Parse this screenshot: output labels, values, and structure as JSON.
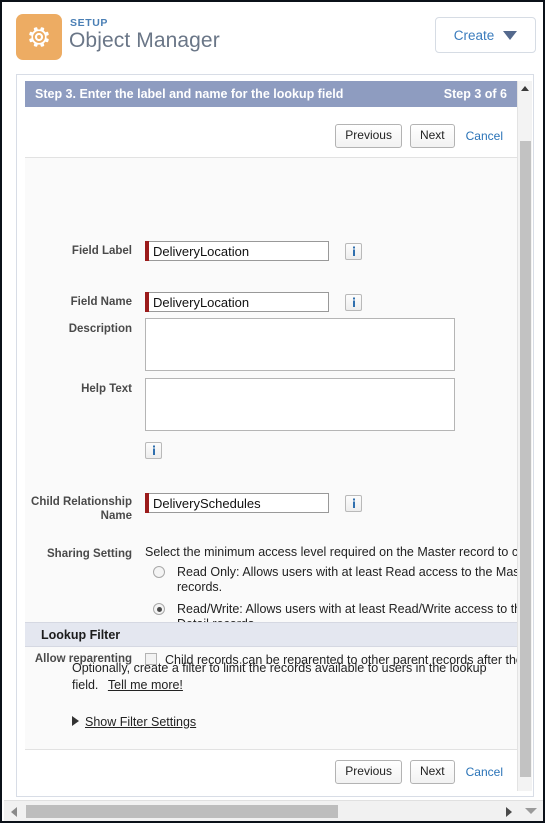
{
  "header": {
    "eyebrow": "SETUP",
    "title": "Object Manager",
    "gear_icon": "gear-icon",
    "create_button": {
      "label": "Create",
      "caret_icon": "chevron-down-icon"
    }
  },
  "wizard": {
    "step_title": "Step 3. Enter the label and name for the lookup field",
    "step_counter": "Step 3 of 6",
    "buttons": {
      "previous": "Previous",
      "next": "Next",
      "cancel": "Cancel"
    },
    "fields": {
      "field_label": {
        "label": "Field Label",
        "value": "DeliveryLocation",
        "placeholder": "",
        "info_icon": "info-icon"
      },
      "field_name": {
        "label": "Field Name",
        "value": "DeliveryLocation",
        "placeholder": "",
        "info_icon": "info-icon"
      },
      "description": {
        "label": "Description",
        "value": "",
        "placeholder": ""
      },
      "help_text": {
        "label": "Help Text",
        "value": "",
        "placeholder": "",
        "info_icon": "info-icon"
      },
      "child_relationship_name": {
        "label": "Child Relationship Name",
        "value": "DeliverySchedules",
        "placeholder": "",
        "info_icon": "info-icon"
      },
      "sharing_setting": {
        "label": "Sharing Setting",
        "intro": "Select the minimum access level required on the Master record to crea",
        "options": [
          {
            "id": "read-only",
            "line1": "Read Only: Allows users with at least Read access to the Master re",
            "line2": "records.",
            "selected": false
          },
          {
            "id": "read-write",
            "line1": "Read/Write: Allows users with at least Read/Write access to the Ma",
            "line2": "Detail records.",
            "selected": true
          }
        ]
      },
      "allow_reparenting": {
        "label": "Allow reparenting",
        "checkbox_text": "Child records can be reparented to other parent records after they a",
        "checked": false
      }
    },
    "lookup_filter": {
      "section_title": "Lookup Filter",
      "description_line1": "Optionally, create a filter to limit the records available to users in the lookup",
      "description_line2": "field.",
      "tell_me_more": "Tell me more!",
      "show_filter_settings": "Show Filter Settings",
      "disclosure_icon": "triangle-right-icon"
    }
  },
  "scrollbars": {
    "vertical": {
      "up_icon": "triangle-up-icon"
    },
    "horizontal": {
      "left_icon": "triangle-left-icon",
      "right_icon": "triangle-right-icon",
      "resize_icon": "triangle-down-icon"
    }
  },
  "colors": {
    "setup_tile": "#edac63",
    "step_bar": "#8e9cc0",
    "link": "#2a73b7",
    "required_marker": "#9b1b1b",
    "section_header": "#e4e7f0"
  }
}
